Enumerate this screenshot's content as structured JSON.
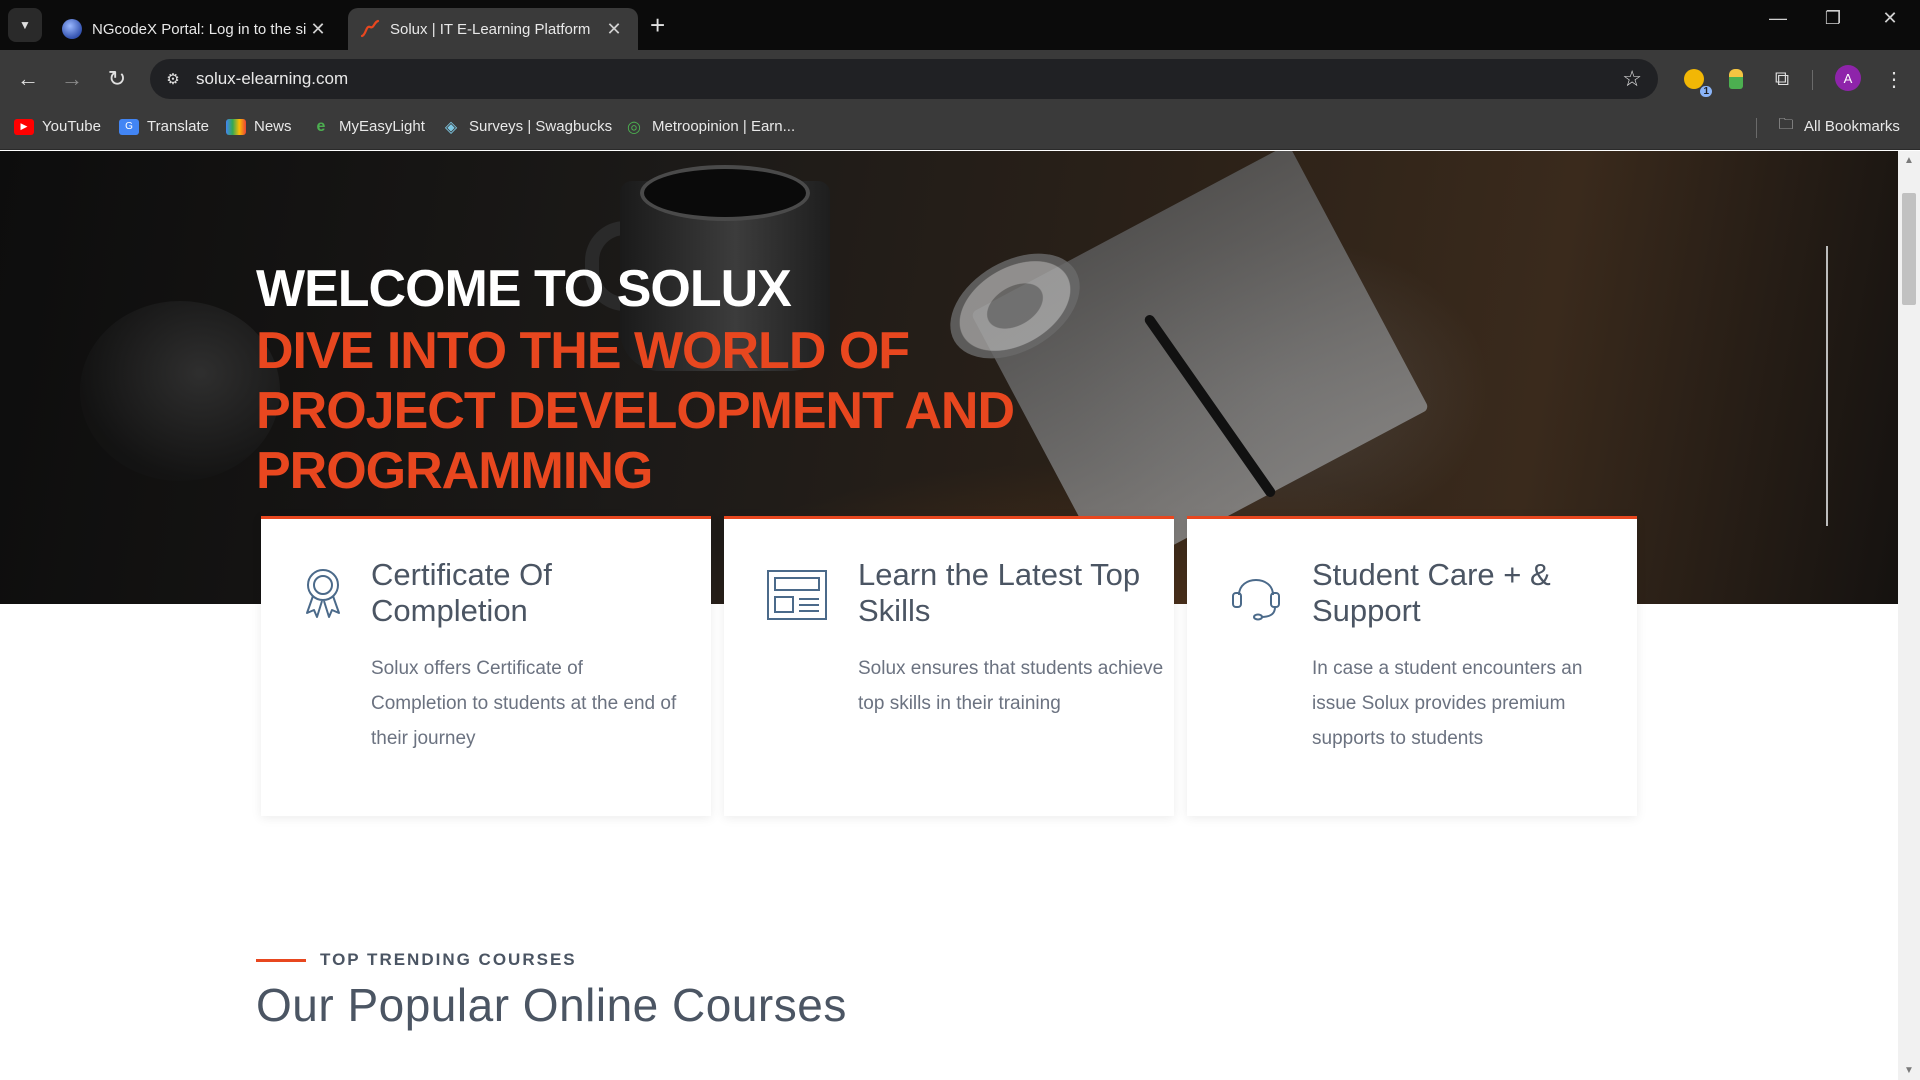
{
  "browser": {
    "tabs": [
      {
        "title": "NGcodeX Portal: Log in to the site",
        "close": "✕"
      },
      {
        "title": "Solux | IT E-Learning Platform",
        "close": "✕"
      }
    ],
    "new_tab": "+",
    "window_controls": {
      "minimize": "—",
      "restore": "❐",
      "close": "✕"
    },
    "url": "solux-elearning.com",
    "extension_badge": "1",
    "profile_initial": "A",
    "bookmarks": [
      {
        "label": "YouTube",
        "icon": "youtube-icon",
        "color": "#ff0000"
      },
      {
        "label": "Translate",
        "icon": "translate-icon",
        "color": "#4285f4"
      },
      {
        "label": "News",
        "icon": "news-icon",
        "color": "#4285f4"
      },
      {
        "label": "MyEasyLight",
        "icon": "myeasylight-icon",
        "color": "#4caf50"
      },
      {
        "label": "Surveys | Swagbucks",
        "icon": "swagbucks-icon",
        "color": "#7ec8e3"
      },
      {
        "label": "Metroopinion | Earn...",
        "icon": "metroopinion-icon",
        "color": "#4caf50"
      }
    ],
    "all_bookmarks": "All Bookmarks"
  },
  "hero": {
    "title": "WELCOME TO SOLUX",
    "subtitle": "DIVE INTO THE WORLD OF PROJECT DEVELOPMENT AND PROGRAMMING"
  },
  "features": [
    {
      "icon": "award-ribbon-icon",
      "title": "Certificate Of Completion",
      "text": "Solux offers Certificate of Completion to students at the end of their journey"
    },
    {
      "icon": "layout-browser-icon",
      "title": "Learn the Latest Top Skills",
      "text": "Solux ensures that students achieve top skills in their training"
    },
    {
      "icon": "headset-icon",
      "title": "Student Care + & Support",
      "text": "In case a student encounters an issue Solux provides premium supports to students"
    }
  ],
  "courses_section": {
    "kicker": "TOP TRENDING COURSES",
    "title": "Our Popular Online Courses"
  },
  "colors": {
    "accent": "#e8471f",
    "text": "#4b5563"
  }
}
